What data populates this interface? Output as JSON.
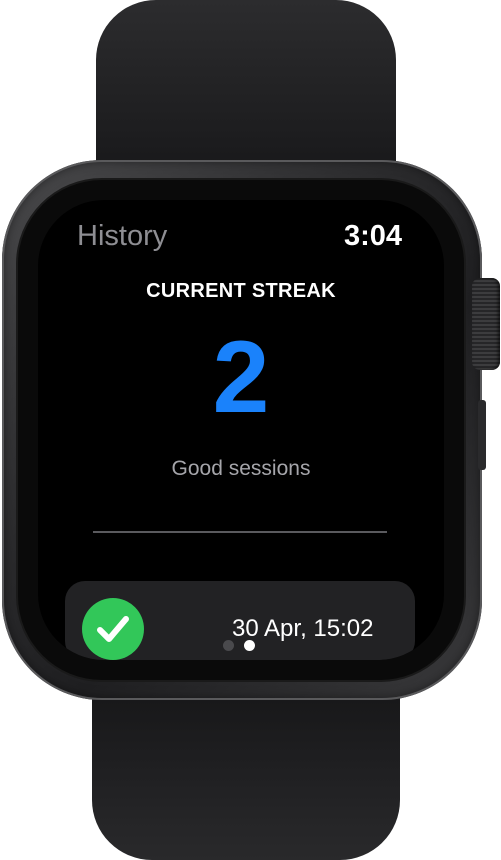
{
  "watch": {
    "nav_title": "History",
    "time": "3:04"
  },
  "streak": {
    "heading": "CURRENT STREAK",
    "value": "2",
    "caption": "Good sessions",
    "accent_color": "#1a82fb"
  },
  "sessions": [
    {
      "status": "good",
      "icon": "checkmark-icon",
      "status_color": "#32c759",
      "date": "30 Apr, 15:02"
    }
  ],
  "pagination": {
    "total": 2,
    "current": 2
  }
}
